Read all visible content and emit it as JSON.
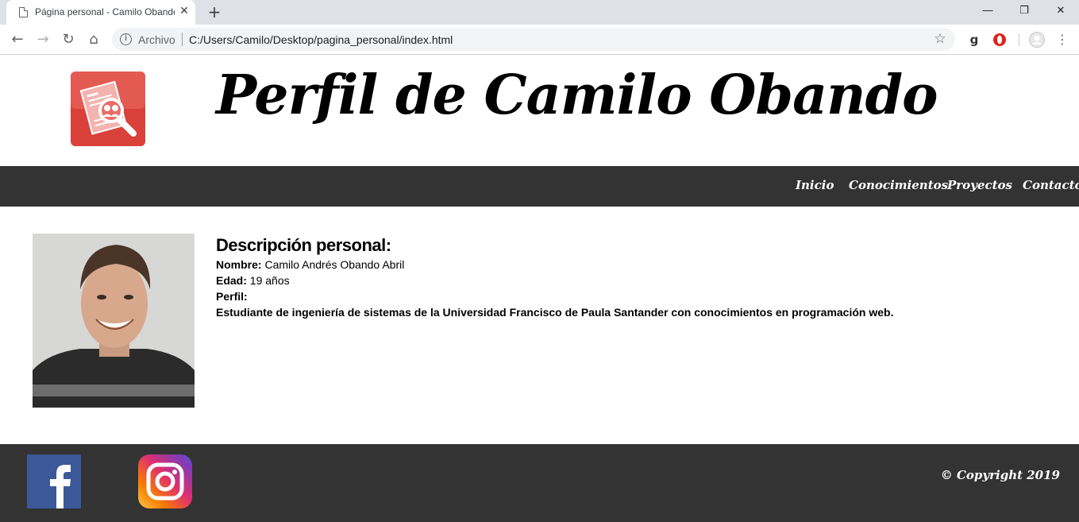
{
  "browser": {
    "tab_title": "Página personal - Camilo Obando Abril",
    "scheme_label": "Archivo",
    "url": "C:/Users/Camilo/Desktop/pagina_personal/index.html",
    "icons": [
      "back-icon",
      "forward-icon",
      "reload-icon",
      "home-icon",
      "info-icon",
      "star-icon",
      "grammarly-icon",
      "opera-icon",
      "profile-icon",
      "menu-icon"
    ]
  },
  "header": {
    "title": "Perfil de Camilo Obando"
  },
  "nav": {
    "items": [
      {
        "label": "Inicio"
      },
      {
        "label": "Conocimientos"
      },
      {
        "label": "Proyectos"
      },
      {
        "label": "Contacto"
      }
    ]
  },
  "profile": {
    "heading": "Descripción personal:",
    "name_label": "Nombre:",
    "name_value": "Camilo Andrés Obando Abril",
    "age_label": "Edad:",
    "age_value": "19 años",
    "profile_label": "Perfil:",
    "profile_text": "Estudiante de ingeniería de sistemas de la Universidad Francisco de Paula Santander con conocimientos en programación web."
  },
  "footer": {
    "copyright": "© Copyright 2019"
  },
  "colors": {
    "bar": "#333333",
    "logo_red": "#d9413a",
    "facebook": "#3b5998"
  }
}
